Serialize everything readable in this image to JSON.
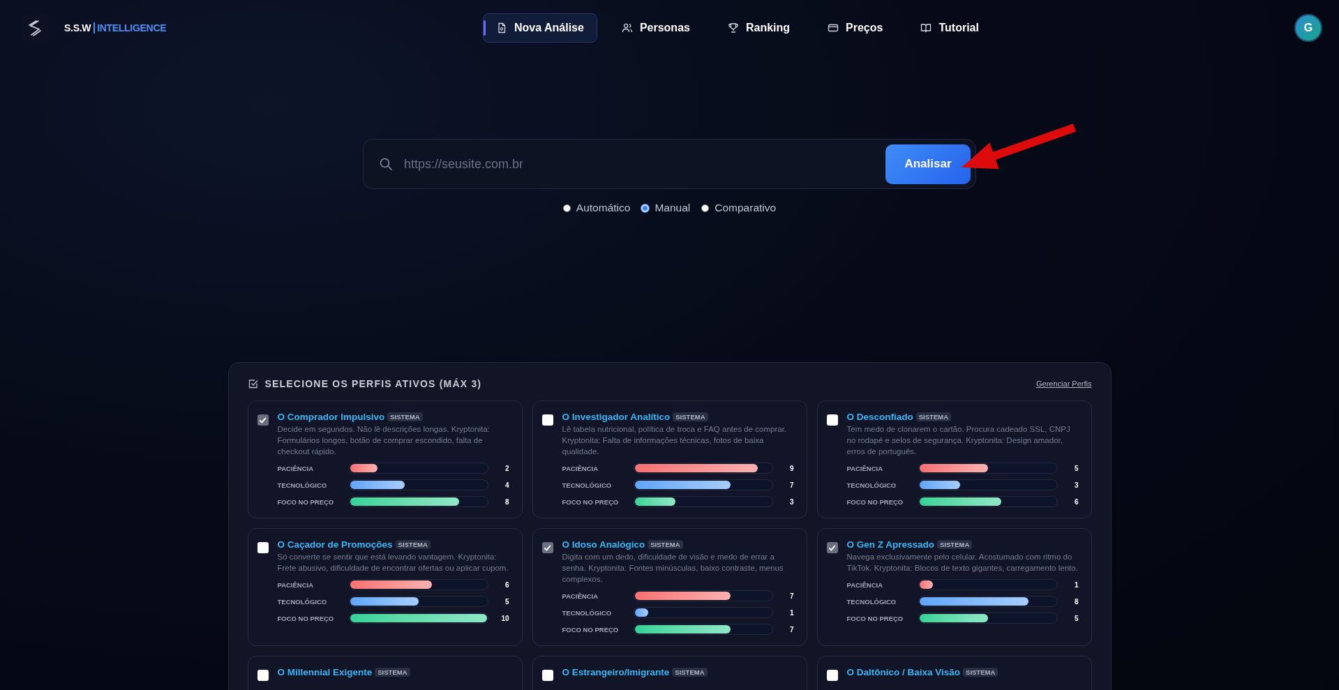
{
  "brand": {
    "name": "S.S.W",
    "suffix": "INTELLIGENCE"
  },
  "nav": [
    {
      "label": "Nova Análise",
      "selected": true
    },
    {
      "label": "Personas",
      "selected": false
    },
    {
      "label": "Ranking",
      "selected": false
    },
    {
      "label": "Preços",
      "selected": false
    },
    {
      "label": "Tutorial",
      "selected": false
    }
  ],
  "avatar": "G",
  "search": {
    "placeholder": "https://seusite.com.br",
    "button": "Analisar"
  },
  "modes": [
    {
      "label": "Automático",
      "selected": false
    },
    {
      "label": "Manual",
      "selected": true
    },
    {
      "label": "Comparativo",
      "selected": false
    }
  ],
  "profiles": {
    "title": "SELECIONE OS PERFIS ATIVOS (MÁX 3)",
    "manage": "Gerenciar Perfis",
    "cards": [
      {
        "name": "O Comprador Impulsivo",
        "badge": "SISTEMA",
        "checked": true,
        "description": "Decide em segundos. Não lê descrições longas. Kryptonita: Formulários longos, botão de comprar escondido, falta de checkout rápido.",
        "stats": [
          {
            "label": "PACIÊNCIA",
            "value": "2",
            "level": 0.2
          },
          {
            "label": "TECNOLÓGICO",
            "value": "4",
            "level": 0.4
          },
          {
            "label": "FOCO NO PREÇO",
            "value": "8",
            "level": 0.8
          }
        ]
      },
      {
        "name": "O Investigador Analítico",
        "badge": "SISTEMA",
        "checked": false,
        "description": "Lê tabela nutricional, política de troca e FAQ antes de comprar. Kryptonita: Falta de informações técnicas, fotos de baixa qualidade.",
        "stats": [
          {
            "label": "PACIÊNCIA",
            "value": "9",
            "level": 0.9
          },
          {
            "label": "TECNOLÓGICO",
            "value": "7",
            "level": 0.7
          },
          {
            "label": "FOCO NO PREÇO",
            "value": "3",
            "level": 0.3
          }
        ]
      },
      {
        "name": "O Desconfiado",
        "badge": "SISTEMA",
        "checked": false,
        "description": "Tem medo de clonarem o cartão. Procura cadeado SSL, CNPJ no rodapé e selos de segurança. Kryptonita: Design amador, erros de português.",
        "stats": [
          {
            "label": "PACIÊNCIA",
            "value": "5",
            "level": 0.5
          },
          {
            "label": "TECNOLÓGICO",
            "value": "3",
            "level": 0.3
          },
          {
            "label": "FOCO NO PREÇO",
            "value": "6",
            "level": 0.6
          }
        ]
      },
      {
        "name": "O Caçador de Promoções",
        "badge": "SISTEMA",
        "checked": false,
        "description": "Só converte se sentir que está levando vantagem. Kryptonita: Frete abusivo, dificuldade de encontrar ofertas ou aplicar cupom.",
        "stats": [
          {
            "label": "PACIÊNCIA",
            "value": "6",
            "level": 0.6
          },
          {
            "label": "TECNOLÓGICO",
            "value": "5",
            "level": 0.5
          },
          {
            "label": "FOCO NO PREÇO",
            "value": "10",
            "level": 1.0
          }
        ]
      },
      {
        "name": "O Idoso Analógico",
        "badge": "SISTEMA",
        "checked": true,
        "description": "Digita com um dedo, dificuldade de visão e medo de errar a senha. Kryptonita: Fontes minúsculas, baixo contraste, menus complexos.",
        "stats": [
          {
            "label": "PACIÊNCIA",
            "value": "7",
            "level": 0.7
          },
          {
            "label": "TECNOLÓGICO",
            "value": "1",
            "level": 0.1
          },
          {
            "label": "FOCO NO PREÇO",
            "value": "7",
            "level": 0.7
          }
        ]
      },
      {
        "name": "O Gen Z Apressado",
        "badge": "SISTEMA",
        "checked": true,
        "description": "Navega exclusivamente pelo celular. Acostumado com ritmo do TikTok. Kryptonita: Blocos de texto gigantes, carregamento lento.",
        "stats": [
          {
            "label": "PACIÊNCIA",
            "value": "1",
            "level": 0.1
          },
          {
            "label": "TECNOLÓGICO",
            "value": "8",
            "level": 0.8
          },
          {
            "label": "FOCO NO PREÇO",
            "value": "5",
            "level": 0.5
          }
        ]
      },
      {
        "name": "O Millennial Exigente",
        "badge": "SISTEMA",
        "checked": false
      },
      {
        "name": "O Estrangeiro/Imigrante",
        "badge": "SISTEMA",
        "checked": false
      },
      {
        "name": "O Daltônico / Baixa Visão",
        "badge": "SISTEMA",
        "checked": false
      }
    ]
  }
}
